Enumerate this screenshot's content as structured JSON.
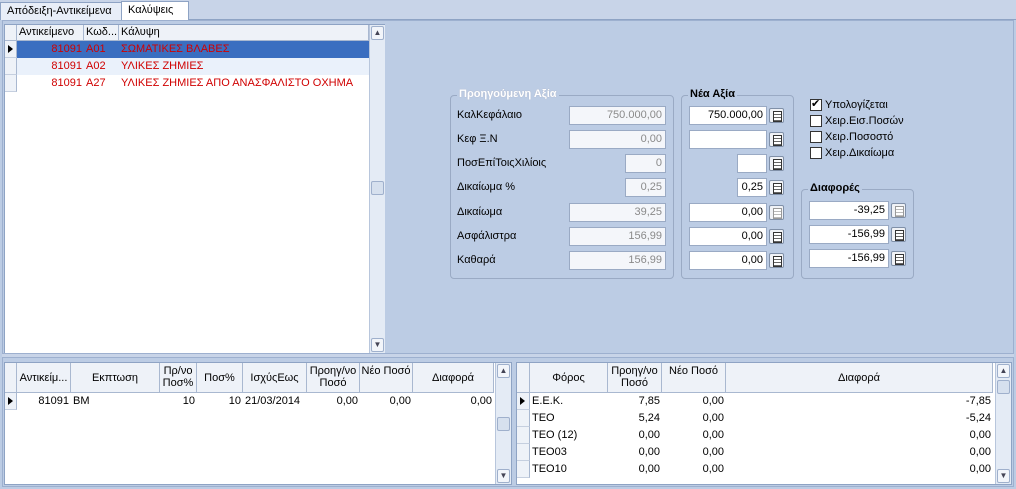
{
  "tabs": [
    {
      "label": "Απόδειξη-Αντικείμενα",
      "active": false
    },
    {
      "label": "Καλύψεις",
      "active": true
    }
  ],
  "coverage_grid": {
    "headers": [
      "Αντικείμενο",
      "Κωδ...",
      "Κάλυψη"
    ],
    "rows": [
      {
        "item": "81091",
        "code": "A01",
        "coverage": "ΣΩΜΑΤΙΚΕΣ ΒΛΑΒΕΣ"
      },
      {
        "item": "81091",
        "code": "A02",
        "coverage": "ΥΛΙΚΕΣ ΖΗΜΙΕΣ"
      },
      {
        "item": "81091",
        "code": "A27",
        "coverage": "ΥΛΙΚΕΣ ΖΗΜΙΕΣ ΑΠΟ ΑΝΑΣΦΑΛΙΣΤΟ ΟΧΗΜΑ"
      }
    ]
  },
  "previous_value": {
    "title": "Προηγούμενη Αξία",
    "fields": [
      {
        "label": "ΚαλΚεφάλαιο",
        "value": "750.000,00"
      },
      {
        "label": "Κεφ Ξ.Ν",
        "value": "0,00"
      },
      {
        "label": "ΠοσΕπίΤοιςΧιλίοις",
        "value": "0"
      },
      {
        "label": "Δικαίωμα %",
        "value": "0,25"
      },
      {
        "label": "Δικαίωμα",
        "value": "39,25"
      },
      {
        "label": "Ασφάλιστρα",
        "value": "156,99"
      },
      {
        "label": "Καθαρά",
        "value": "156,99"
      }
    ]
  },
  "new_value": {
    "title": "Νέα Αξία",
    "values": [
      "750.000,00",
      "",
      "",
      "0,25",
      "0,00",
      "0,00",
      "0,00"
    ]
  },
  "options": [
    {
      "label": "Υπολογίζεται",
      "checked": true
    },
    {
      "label": "Χειρ.Εισ.Ποσών",
      "checked": false
    },
    {
      "label": "Χειρ.Ποσοστό",
      "checked": false
    },
    {
      "label": "Χειρ.Δικαίωμα",
      "checked": false
    }
  ],
  "differences": {
    "title": "Διαφορές",
    "values": [
      "-39,25",
      "-156,99",
      "-156,99"
    ]
  },
  "discount_grid": {
    "headers": [
      "Αντικείμ...",
      "Εκπτωση",
      "Πρ/νο Ποσ%",
      "Ποσ%",
      "ΙσχύςΕως",
      "Προηγ/νο Ποσό",
      "Νέο Ποσό",
      "Διαφορά"
    ],
    "rows": [
      {
        "item": "81091",
        "discount": "BM",
        "prev_pct": "10",
        "pct": "10",
        "valid_until": "21/03/2014",
        "prev_amount": "0,00",
        "new_amount": "0,00",
        "diff": "0,00"
      }
    ]
  },
  "tax_grid": {
    "headers": [
      "Φόρος",
      "Προηγ/νο Ποσό",
      "Νέο Ποσό",
      "Διαφορά"
    ],
    "rows": [
      {
        "tax": "Ε.Ε.Κ.",
        "prev": "7,85",
        "new": "0,00",
        "diff": "-7,85"
      },
      {
        "tax": "ΤΕΟ",
        "prev": "5,24",
        "new": "0,00",
        "diff": "-5,24"
      },
      {
        "tax": "ΤΕΟ (12)",
        "prev": "0,00",
        "new": "0,00",
        "diff": "0,00"
      },
      {
        "tax": "ΤΕΟ03",
        "prev": "0,00",
        "new": "0,00",
        "diff": "0,00"
      },
      {
        "tax": "ΤΕΟ10",
        "prev": "0,00",
        "new": "0,00",
        "diff": "0,00"
      }
    ]
  }
}
